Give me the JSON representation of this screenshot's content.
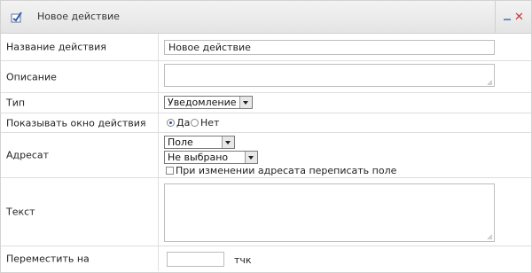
{
  "window": {
    "title": "Новое действие",
    "title_icon": "action-icon",
    "minimize_icon": "minimize-icon",
    "close_icon": "close-icon",
    "close_glyph": "✕"
  },
  "form": {
    "name": {
      "label": "Название действия",
      "value": "Новое действие"
    },
    "description": {
      "label": "Описание",
      "value": ""
    },
    "type": {
      "label": "Тип",
      "selected": "Уведомление"
    },
    "show_window": {
      "label": "Показывать окно действия",
      "options": [
        {
          "label": "Да",
          "checked": true
        },
        {
          "label": "Нет",
          "checked": false
        }
      ]
    },
    "recipient": {
      "label": "Адресат",
      "field_select": "Поле",
      "value_select": "Не выбрано",
      "overwrite_checkbox": {
        "label": "При изменении адресата переписать поле",
        "checked": false
      }
    },
    "text": {
      "label": "Текст",
      "value": ""
    },
    "move_to": {
      "label": "Переместить на",
      "value": "",
      "unit": "тчк"
    }
  },
  "colors": {
    "close": "#d0343a",
    "minimize": "#6a8fc2",
    "border": "#dedede"
  }
}
